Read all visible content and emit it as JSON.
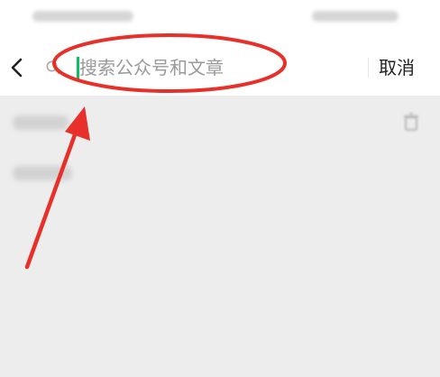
{
  "search": {
    "placeholder": "搜索公众号和文章",
    "value": ""
  },
  "cancel_label": "取消",
  "icons": {
    "back": "chevron-left-icon",
    "search": "search-icon",
    "delete": "trash-icon"
  },
  "colors": {
    "caret": "#07c160",
    "annotation": "#e8302a",
    "background": "#ededed"
  }
}
